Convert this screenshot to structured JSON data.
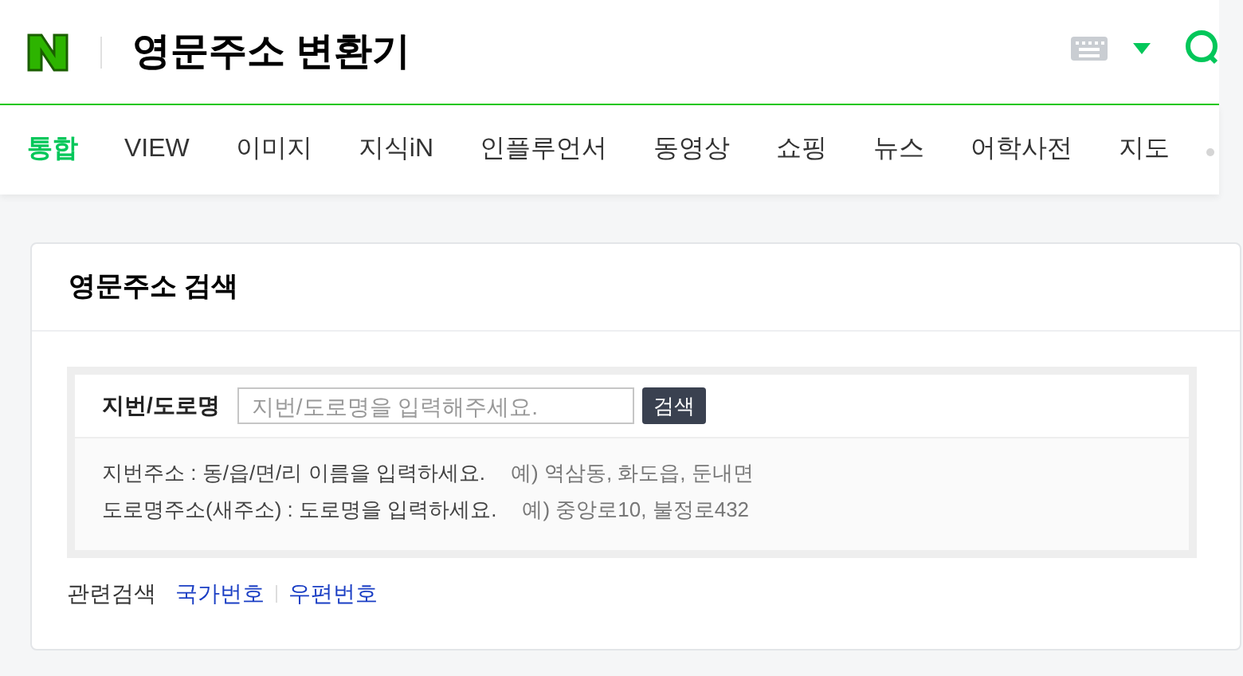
{
  "header": {
    "title": "영문주소 변환기"
  },
  "tabs": [
    {
      "label": "통합",
      "selected": true
    },
    {
      "label": "VIEW",
      "selected": false
    },
    {
      "label": "이미지",
      "selected": false
    },
    {
      "label": "지식iN",
      "selected": false
    },
    {
      "label": "인플루언서",
      "selected": false
    },
    {
      "label": "동영상",
      "selected": false
    },
    {
      "label": "쇼핑",
      "selected": false
    },
    {
      "label": "뉴스",
      "selected": false
    },
    {
      "label": "어학사전",
      "selected": false
    },
    {
      "label": "지도",
      "selected": false
    }
  ],
  "card": {
    "title": "영문주소 검색",
    "search": {
      "label": "지번/도로명",
      "placeholder": "지번/도로명을 입력해주세요.",
      "button": "검색"
    },
    "hints": [
      {
        "text": "지번주소 : 동/읍/면/리 이름을 입력하세요.",
        "example": "예) 역삼동, 화도읍, 둔내면"
      },
      {
        "text": "도로명주소(새주소) : 도로명을 입력하세요.",
        "example": "예) 중앙로10, 불정로432"
      }
    ],
    "related": {
      "label": "관련검색",
      "links": [
        "국가번호",
        "우편번호"
      ]
    }
  }
}
